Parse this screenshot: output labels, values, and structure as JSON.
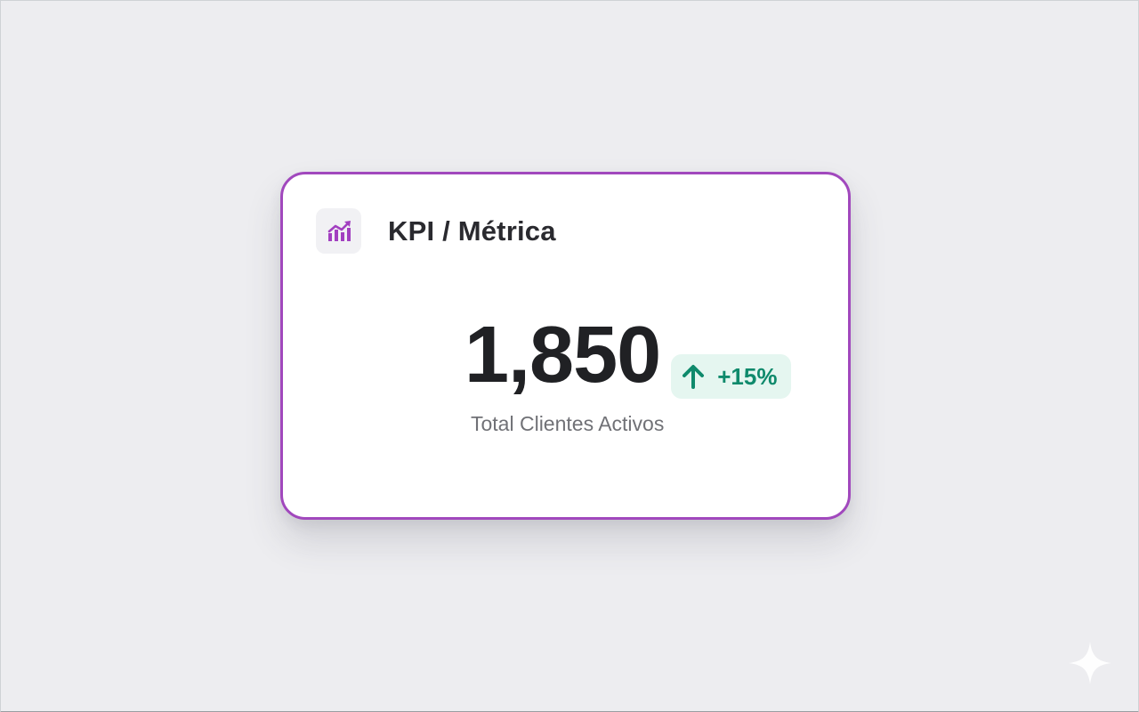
{
  "card": {
    "title": "KPI / Métrica",
    "icon": "trending-chart-icon",
    "value": "1,850",
    "change": "+15%",
    "change_direction": "up",
    "label": "Total Clientes Activos"
  },
  "colors": {
    "accent": "#a148bd",
    "positive": "#0f8a6c",
    "positive_bg": "#e5f6f0",
    "background": "#eceef1"
  },
  "decorations": {
    "corner_icon": "sparkle-icon"
  }
}
